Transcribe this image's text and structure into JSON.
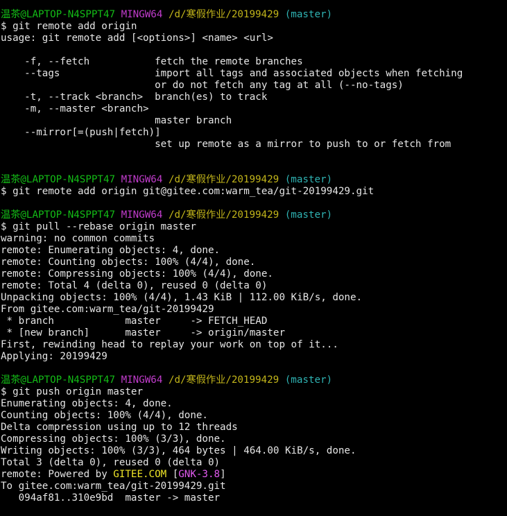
{
  "colors": {
    "background": "#000000",
    "text": "#e6e6e6",
    "user_host": "#13bc16",
    "shell_name": "#c13ccc",
    "path": "#c2b51a",
    "branch": "#2fb3b3",
    "highlight_yellow": "#f0e628",
    "highlight_purple": "#e25af0"
  },
  "lines": [
    {
      "segs": [
        {
          "t": "温茶@LAPTOP-N4SPPT47",
          "c": "green"
        },
        {
          "t": " "
        },
        {
          "t": "MINGW64",
          "c": "purple"
        },
        {
          "t": " "
        },
        {
          "t": "/d/寒假作业/20199429",
          "c": "yellow"
        },
        {
          "t": " "
        },
        {
          "t": "(master)",
          "c": "cyan"
        }
      ]
    },
    {
      "segs": [
        {
          "t": "$ git remote add origin"
        }
      ]
    },
    {
      "segs": [
        {
          "t": "usage: git remote add [<options>] <name> <url>"
        }
      ]
    },
    {
      "segs": [
        {
          "t": ""
        }
      ]
    },
    {
      "segs": [
        {
          "t": "    -f, --fetch           fetch the remote branches"
        }
      ]
    },
    {
      "segs": [
        {
          "t": "    --tags                import all tags and associated objects when fetching"
        }
      ]
    },
    {
      "segs": [
        {
          "t": "                          or do not fetch any tag at all (--no-tags)"
        }
      ]
    },
    {
      "segs": [
        {
          "t": "    -t, --track <branch>  branch(es) to track"
        }
      ]
    },
    {
      "segs": [
        {
          "t": "    -m, --master <branch>"
        }
      ]
    },
    {
      "segs": [
        {
          "t": "                          master branch"
        }
      ]
    },
    {
      "segs": [
        {
          "t": "    --mirror[=(push|fetch)]"
        }
      ]
    },
    {
      "segs": [
        {
          "t": "                          set up remote as a mirror to push to or fetch from"
        }
      ]
    },
    {
      "segs": [
        {
          "t": ""
        }
      ]
    },
    {
      "segs": [
        {
          "t": ""
        }
      ]
    },
    {
      "segs": [
        {
          "t": "温茶@LAPTOP-N4SPPT47",
          "c": "green"
        },
        {
          "t": " "
        },
        {
          "t": "MINGW64",
          "c": "purple"
        },
        {
          "t": " "
        },
        {
          "t": "/d/寒假作业/20199429",
          "c": "yellow"
        },
        {
          "t": " "
        },
        {
          "t": "(master)",
          "c": "cyan"
        }
      ]
    },
    {
      "segs": [
        {
          "t": "$ git remote add origin git@gitee.com:warm_tea/git-20199429.git"
        }
      ]
    },
    {
      "segs": [
        {
          "t": ""
        }
      ]
    },
    {
      "segs": [
        {
          "t": "温茶@LAPTOP-N4SPPT47",
          "c": "green"
        },
        {
          "t": " "
        },
        {
          "t": "MINGW64",
          "c": "purple"
        },
        {
          "t": " "
        },
        {
          "t": "/d/寒假作业/20199429",
          "c": "yellow"
        },
        {
          "t": " "
        },
        {
          "t": "(master)",
          "c": "cyan"
        }
      ]
    },
    {
      "segs": [
        {
          "t": "$ git pull --rebase origin master"
        }
      ]
    },
    {
      "segs": [
        {
          "t": "warning: no common commits"
        }
      ]
    },
    {
      "segs": [
        {
          "t": "remote: Enumerating objects: 4, done."
        }
      ]
    },
    {
      "segs": [
        {
          "t": "remote: Counting objects: 100% (4/4), done."
        }
      ]
    },
    {
      "segs": [
        {
          "t": "remote: Compressing objects: 100% (4/4), done."
        }
      ]
    },
    {
      "segs": [
        {
          "t": "remote: Total 4 (delta 0), reused 0 (delta 0)"
        }
      ]
    },
    {
      "segs": [
        {
          "t": "Unpacking objects: 100% (4/4), 1.43 KiB | 112.00 KiB/s, done."
        }
      ]
    },
    {
      "segs": [
        {
          "t": "From gitee.com:warm_tea/git-20199429"
        }
      ]
    },
    {
      "segs": [
        {
          "t": " * branch            master     -> FETCH_HEAD"
        }
      ]
    },
    {
      "segs": [
        {
          "t": " * [new branch]      master     -> origin/master"
        }
      ]
    },
    {
      "segs": [
        {
          "t": "First, rewinding head to replay your work on top of it..."
        }
      ]
    },
    {
      "segs": [
        {
          "t": "Applying: 20199429"
        }
      ]
    },
    {
      "segs": [
        {
          "t": ""
        }
      ]
    },
    {
      "segs": [
        {
          "t": "温茶@LAPTOP-N4SPPT47",
          "c": "green"
        },
        {
          "t": " "
        },
        {
          "t": "MINGW64",
          "c": "purple"
        },
        {
          "t": " "
        },
        {
          "t": "/d/寒假作业/20199429",
          "c": "yellow"
        },
        {
          "t": " "
        },
        {
          "t": "(master)",
          "c": "cyan"
        }
      ]
    },
    {
      "segs": [
        {
          "t": "$ git push origin master"
        }
      ]
    },
    {
      "segs": [
        {
          "t": "Enumerating objects: 4, done."
        }
      ]
    },
    {
      "segs": [
        {
          "t": "Counting objects: 100% (4/4), done."
        }
      ]
    },
    {
      "segs": [
        {
          "t": "Delta compression using up to 12 threads"
        }
      ]
    },
    {
      "segs": [
        {
          "t": "Compressing objects: 100% (3/3), done."
        }
      ]
    },
    {
      "segs": [
        {
          "t": "Writing objects: 100% (3/3), 464 bytes | 464.00 KiB/s, done."
        }
      ]
    },
    {
      "segs": [
        {
          "t": "Total 3 (delta 0), reused 0 (delta 0)"
        }
      ]
    },
    {
      "segs": [
        {
          "t": "remote: Powered by "
        },
        {
          "t": "GITEE.COM",
          "c": "bright-yellow"
        },
        {
          "t": " ["
        },
        {
          "t": "GNK-3.8",
          "c": "bright-purple"
        },
        {
          "t": "]"
        }
      ]
    },
    {
      "segs": [
        {
          "t": "To gitee.com:warm_tea/git-20199429.git"
        }
      ]
    },
    {
      "segs": [
        {
          "t": "   094af81..310e9bd  master -> master"
        }
      ]
    }
  ]
}
